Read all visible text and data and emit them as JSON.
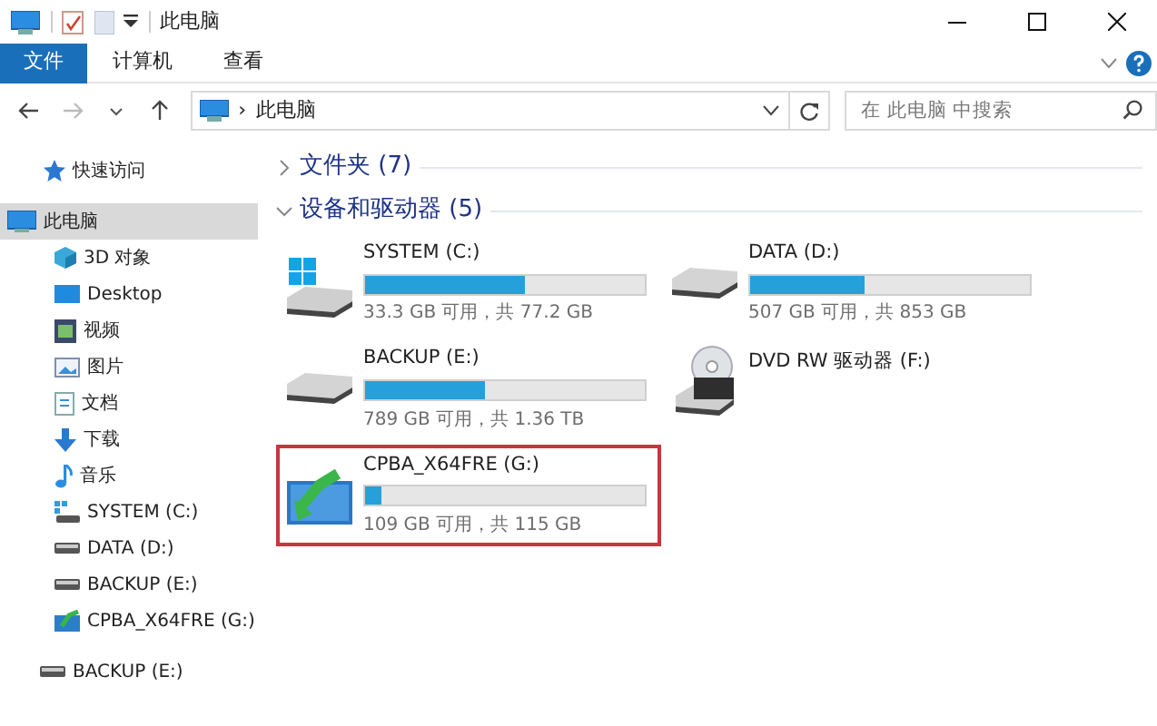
{
  "window": {
    "title": "此电脑"
  },
  "ribbon_tabs": [
    {
      "label": "文件",
      "kind": "file"
    },
    {
      "label": "计算机",
      "kind": "tab"
    },
    {
      "label": "查看",
      "kind": "tab"
    }
  ],
  "address_bar": {
    "path": [
      "此电脑"
    ],
    "separator": "›"
  },
  "search": {
    "placeholder": "在 此电脑 中搜索"
  },
  "sidebar": {
    "items": [
      {
        "label": "快速访问",
        "kind": "star",
        "selected": false
      },
      {
        "label": "此电脑",
        "kind": "pc",
        "selected": true,
        "children": [
          {
            "label": "3D 对象",
            "kind": "cube",
            "selected": false
          },
          {
            "label": "Desktop",
            "kind": "desktop",
            "selected": false
          },
          {
            "label": "视频",
            "kind": "video",
            "selected": false
          },
          {
            "label": "图片",
            "kind": "picture",
            "selected": false
          },
          {
            "label": "文档",
            "kind": "document",
            "selected": false
          },
          {
            "label": "下载",
            "kind": "download",
            "selected": false
          },
          {
            "label": "音乐",
            "kind": "music",
            "selected": false
          },
          {
            "label": "SYSTEM (C:)",
            "kind": "system",
            "selected": false
          },
          {
            "label": "DATA (D:)",
            "kind": "drive",
            "selected": false
          },
          {
            "label": "BACKUP (E:)",
            "kind": "drive",
            "selected": false
          },
          {
            "label": "CPBA_X64FRE (G:)",
            "kind": "usb",
            "selected": false
          }
        ]
      },
      {
        "label": "BACKUP (E:)",
        "kind": "drive",
        "selected": false
      }
    ]
  },
  "groups": [
    {
      "title": "文件夹 (7)",
      "expanded": false
    },
    {
      "title": "设备和驱动器 (5)",
      "expanded": true,
      "drives": [
        {
          "name": "SYSTEM (C:)",
          "kind": "system",
          "level": 0.57,
          "space": "33.3 GB 可用，共 77.2 GB",
          "highlighted": false
        },
        {
          "name": "DATA (D:)",
          "kind": "drive",
          "level": 0.41,
          "space": "507 GB 可用，共 853 GB",
          "highlighted": false
        },
        {
          "name": "BACKUP (E:)",
          "kind": "drive",
          "level": 0.43,
          "space": "789 GB 可用，共 1.36 TB",
          "highlighted": false
        },
        {
          "name": "DVD RW 驱动器 (F:)",
          "kind": "dvd",
          "highlighted": false
        },
        {
          "name": "CPBA_X64FRE (G:)",
          "kind": "usb",
          "level": 0.06,
          "space": "109 GB 可用，共 115 GB",
          "highlighted": true
        }
      ]
    }
  ]
}
